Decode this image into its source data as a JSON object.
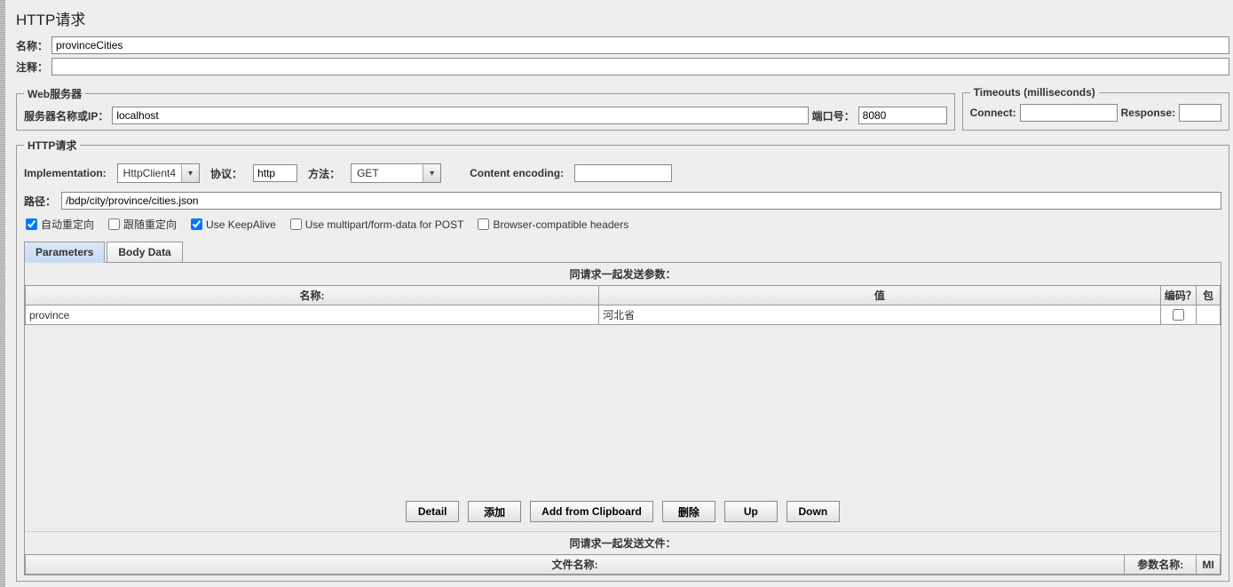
{
  "title": "HTTP请求",
  "labels": {
    "name": "名称：",
    "comment": "注释：",
    "web_server": "Web服务器",
    "server_ip": "服务器名称或IP：",
    "port": "端口号：",
    "timeouts": "Timeouts (milliseconds)",
    "connect": "Connect:",
    "response": "Response:",
    "http_request": "HTTP请求",
    "implementation": "Implementation:",
    "protocol": "协议：",
    "method": "方法：",
    "content_encoding": "Content encoding:",
    "path": "路径："
  },
  "fields": {
    "name": "provinceCities",
    "comment": "",
    "server_ip": "localhost",
    "port": "8080",
    "connect": "",
    "response": "",
    "implementation": "HttpClient4",
    "protocol": "http",
    "method": "GET",
    "content_encoding": "",
    "path": "/bdp/city/province/cities.json"
  },
  "checkboxes": {
    "auto_redirect": {
      "label": "自动重定向",
      "checked": true
    },
    "follow_redirect": {
      "label": "跟随重定向",
      "checked": false
    },
    "keepalive": {
      "label": "Use KeepAlive",
      "checked": true
    },
    "multipart": {
      "label": "Use multipart/form-data for POST",
      "checked": false
    },
    "browser_compat": {
      "label": "Browser-compatible headers",
      "checked": false
    }
  },
  "tabs": {
    "parameters": "Parameters",
    "body_data": "Body Data"
  },
  "params_section": {
    "title": "同请求一起发送参数：",
    "headers": {
      "name": "名称:",
      "value": "值",
      "encode": "编码？",
      "include": "包"
    },
    "rows": [
      {
        "name": "province",
        "value": "河北省",
        "encode": false
      }
    ]
  },
  "buttons": {
    "detail": "Detail",
    "add": "添加",
    "add_clipboard": "Add from Clipboard",
    "delete": "删除",
    "up": "Up",
    "down": "Down"
  },
  "files_section": {
    "title": "同请求一起发送文件：",
    "headers": {
      "filepath": "文件名称:",
      "paramname": "参数名称:",
      "mime": "MI"
    }
  }
}
